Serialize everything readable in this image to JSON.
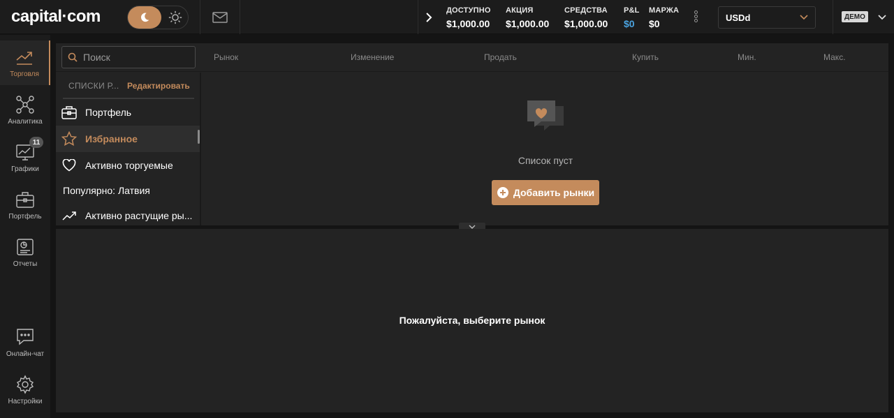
{
  "brand": {
    "logo_text": "capital·com"
  },
  "colors": {
    "accent": "#c48b5c",
    "pnl": "#4aa3e0",
    "bg": "#141414",
    "panel": "#232323"
  },
  "header": {
    "stats": [
      {
        "label": "ДОСТУПНО",
        "value": "$1,000.00"
      },
      {
        "label": "АКЦИЯ",
        "value": "$1,000.00"
      },
      {
        "label": "СРЕДСТВА",
        "value": "$1,000.00"
      },
      {
        "label": "P&L",
        "value": "$0"
      },
      {
        "label": "МАРЖА",
        "value": "$0"
      }
    ],
    "account": "USDd",
    "mode_badge": "ДЕМО"
  },
  "nav": [
    {
      "label": "Торговля",
      "icon": "trend-chart-icon"
    },
    {
      "label": "Аналитика",
      "icon": "network-icon"
    },
    {
      "label": "Графики",
      "icon": "monitor-chart-icon",
      "badge": "11"
    },
    {
      "label": "Портфель",
      "icon": "briefcase-icon"
    },
    {
      "label": "Отчеты",
      "icon": "report-icon"
    },
    {
      "label": "Онлайн-чат",
      "icon": "chat-icon"
    },
    {
      "label": "Настройки",
      "icon": "gear-icon"
    }
  ],
  "search": {
    "placeholder": "Поиск"
  },
  "columns": [
    "Рынок",
    "Изменение",
    "Продать",
    "Купить",
    "Мин.",
    "Макс."
  ],
  "watchlists": {
    "title": "СПИСКИ Р...",
    "edit_label": "Редактировать",
    "items": [
      {
        "label": "Портфель",
        "icon": "briefcase-icon"
      },
      {
        "label": "Избранное",
        "icon": "star-icon"
      },
      {
        "label": "Активно торгуемые",
        "icon": "heart-icon"
      },
      {
        "label": "Популярно: Латвия",
        "icon": ""
      },
      {
        "label": "Активно растущие ры...",
        "icon": "trending-up-icon"
      }
    ]
  },
  "empty_state": {
    "message": "Список пуст",
    "button_label": "Добавить рынки"
  },
  "detail": {
    "message": "Пожалуйста, выберите рынок"
  }
}
